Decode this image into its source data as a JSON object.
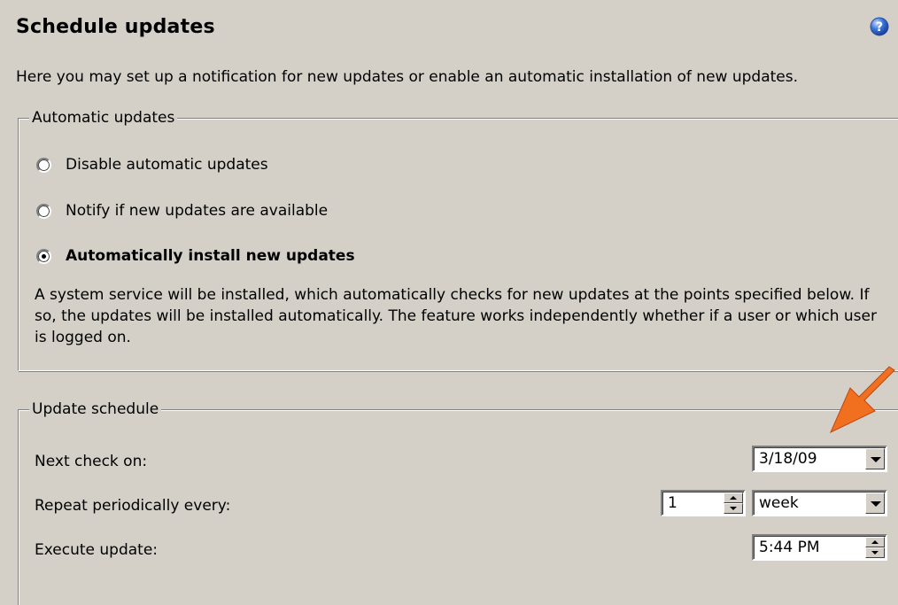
{
  "header": {
    "title": "Schedule updates",
    "help_icon": "help-question-icon",
    "intro": "Here you may set up a notification for new updates or enable an automatic installation of new updates."
  },
  "automatic_updates": {
    "group_label": "Automatic updates",
    "options": [
      {
        "label": "Disable automatic updates",
        "checked": false
      },
      {
        "label": "Notify if new updates are available",
        "checked": false
      },
      {
        "label": "Automatically install new updates",
        "checked": true
      }
    ],
    "description": "A system service will be installed, which automatically checks for new updates at the points specified below. If so, the updates will be installed automatically. The feature works independently whether if a user or which user is logged on."
  },
  "update_schedule": {
    "group_label": "Update schedule",
    "next_check_label": "Next check on:",
    "next_check_value": "3/18/09",
    "repeat_label": "Repeat periodically every:",
    "repeat_count": "1",
    "repeat_unit": "week",
    "execute_label": "Execute update:",
    "execute_time": "5:44 PM"
  },
  "annotation": {
    "arrow_icon": "orange-arrow-icon",
    "arrow_color": "#f07020"
  }
}
